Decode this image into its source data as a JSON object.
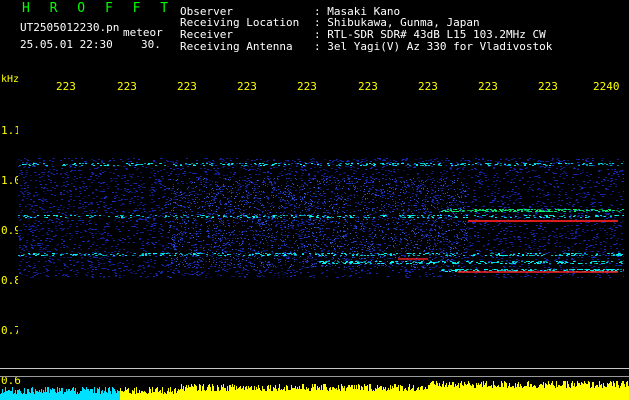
{
  "header": {
    "brand": "H R O F F T",
    "file_name": "UT2505012230.pn",
    "file_kind": "meteor",
    "date_time": "25.05.01 22:30",
    "seconds": "30."
  },
  "info": [
    {
      "label": "Observer",
      "value": ": Masaki Kano"
    },
    {
      "label": "Receiving Location",
      "value": ": Shibukawa, Gunma, Japan"
    },
    {
      "label": "Receiver",
      "value": ": RTL-SDR SDR# 43dB L15 103.2MHz CW"
    },
    {
      "label": "Receiving Antenna",
      "value": ": 3el Yagi(V) Az 330 for Vladivostok"
    }
  ],
  "axes": {
    "y_unit": "kHz",
    "x_ticks": [
      "223",
      "223",
      "223",
      "223",
      "223",
      "223",
      "223",
      "223",
      "223",
      "2240"
    ],
    "y_ticks": [
      "1.1",
      "1.0",
      "0.9",
      "0.8",
      "0.7",
      "0.6"
    ]
  },
  "colors": {
    "text_primary": "#ffffff",
    "axis_text": "#ffff00",
    "brand": "#00ff00",
    "background": "#000000",
    "noise": "#1a2fd6",
    "signal": "#00ffff",
    "strong_signal": "#ff2020",
    "spectrum_fill": "#ffff00",
    "spectrum_left": "#00e0ff"
  }
}
